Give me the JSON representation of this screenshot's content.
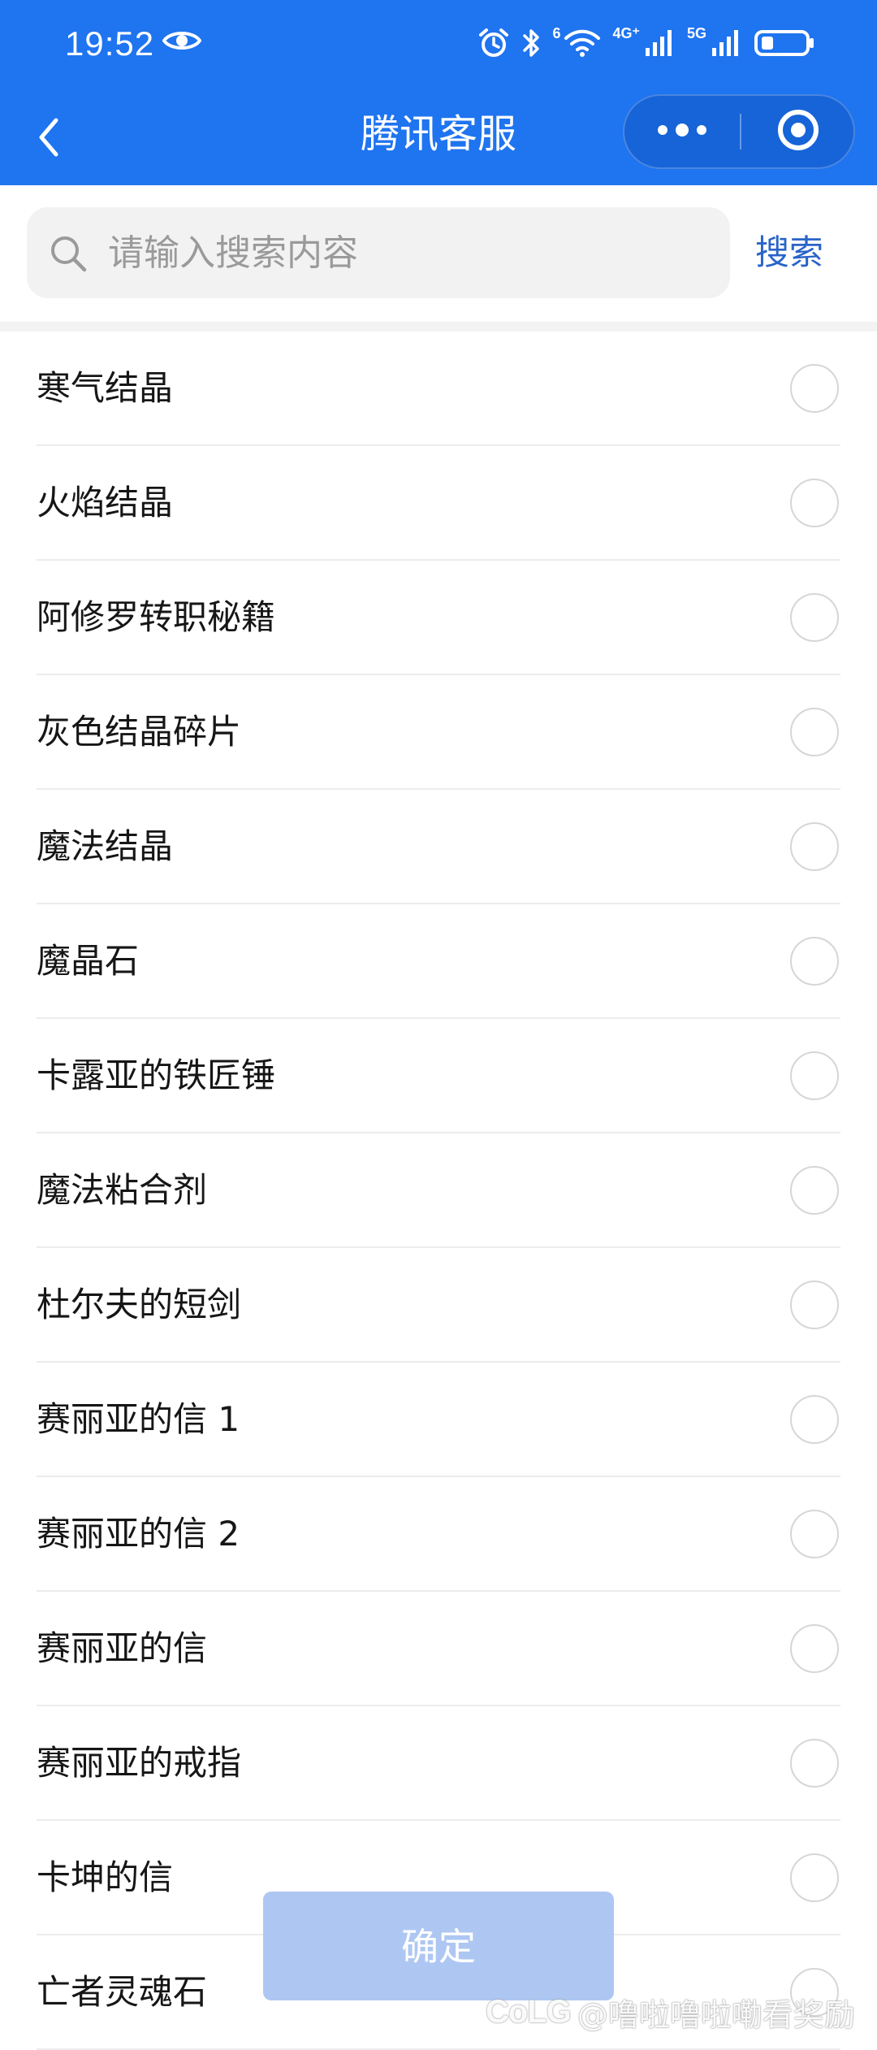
{
  "status_bar": {
    "time": "19:52",
    "wifi_label": "6",
    "signal1_label": "4G⁺",
    "signal2_label": "5G",
    "icons": [
      "eye-icon",
      "alarm-icon",
      "bluetooth-icon",
      "wifi-icon",
      "signal-icon",
      "signal-icon",
      "battery-icon"
    ]
  },
  "nav": {
    "title": "腾讯客服",
    "icons": [
      "back-arrow-icon",
      "more-dots-icon",
      "close-target-icon"
    ]
  },
  "search": {
    "placeholder": "请输入搜索内容",
    "value": "",
    "button_label": "搜索"
  },
  "items": [
    {
      "label": "寒气结晶",
      "selected": false
    },
    {
      "label": "火焰结晶",
      "selected": false
    },
    {
      "label": "阿修罗转职秘籍",
      "selected": false
    },
    {
      "label": "灰色结晶碎片",
      "selected": false
    },
    {
      "label": "魔法结晶",
      "selected": false
    },
    {
      "label": "魔晶石",
      "selected": false
    },
    {
      "label": "卡露亚的铁匠锤",
      "selected": false
    },
    {
      "label": "魔法粘合剂",
      "selected": false
    },
    {
      "label": "杜尔夫的短剑",
      "selected": false
    },
    {
      "label": "赛丽亚的信 1",
      "selected": false
    },
    {
      "label": "赛丽亚的信 2",
      "selected": false
    },
    {
      "label": "赛丽亚的信",
      "selected": false
    },
    {
      "label": "赛丽亚的戒指",
      "selected": false
    },
    {
      "label": "卡坤的信",
      "selected": false
    },
    {
      "label": "亡者灵魂石",
      "selected": false
    }
  ],
  "confirm_label": "确定",
  "watermark": {
    "logo": "CoLG",
    "text": "@噜啦噜啦嘞看奖励"
  },
  "colors": {
    "header_blue": "#1f74f0",
    "link_blue": "#2a64c8",
    "confirm_disabled": "#aec7f2"
  }
}
